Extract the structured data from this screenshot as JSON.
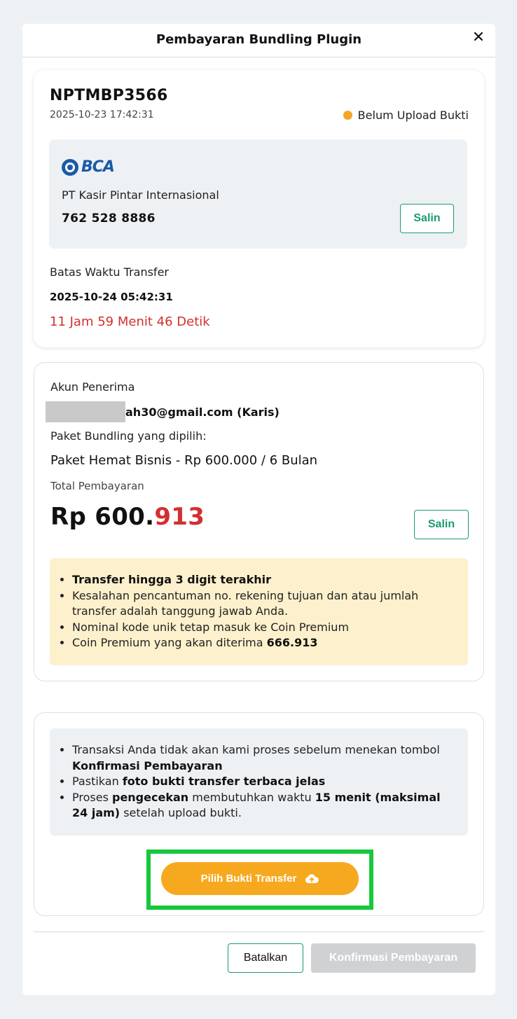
{
  "modal": {
    "title": "Pembayaran Bundling Plugin",
    "close_label": "×"
  },
  "invoice": {
    "id": "NPTMBP3566",
    "date": "2025-10-23 17:42:31",
    "status": "Belum Upload Bukti",
    "status_color": "#f5a623"
  },
  "bank": {
    "logo_text": "BCA",
    "account_name": "PT Kasir Pintar Internasional",
    "account_number": "762 528 8886",
    "copy_label": "Salin"
  },
  "deadline": {
    "label": "Batas Waktu Transfer",
    "value": "2025-10-24 05:42:31",
    "countdown": "11 Jam 59 Menit 46 Detik"
  },
  "receiver": {
    "label": "Akun Penerima",
    "email_visible": "ah30@gmail.com (Karis)"
  },
  "package": {
    "label": "Paket Bundling yang dipilih:",
    "value": "Paket Hemat Bisnis - Rp 600.000 / 6 Bulan"
  },
  "total": {
    "label": "Total Pembayaran",
    "prefix": "Rp 600.",
    "unique_digits": "913",
    "copy_label": "Salin"
  },
  "notice_transfer": {
    "b1_bold": "Transfer hingga ",
    "b1_red": "3 digit terakhir",
    "b2": "Kesalahan pencantuman no. rekening tujuan dan atau jumlah transfer adalah tanggung jawab Anda.",
    "b3": "Nominal kode unik tetap masuk ke Coin Premium",
    "b4_text": "Coin Premium yang akan diterima ",
    "b4_bold": "666.913"
  },
  "notice_upload": {
    "b1_text": "Transaksi Anda tidak akan kami proses sebelum menekan tombol ",
    "b1_bold": "Konfirmasi Pembayaran",
    "b2_text": "Pastikan ",
    "b2_bold": "foto bukti transfer terbaca jelas",
    "b3_text1": "Proses ",
    "b3_bold1": "pengecekan",
    "b3_text2": " membutuhkan waktu ",
    "b3_bold2": "15 menit (maksimal 24 jam)",
    "b3_text3": " setelah upload bukti."
  },
  "upload_button": {
    "label": "Pilih Bukti Transfer",
    "icon": "cloud-upload-icon"
  },
  "footer": {
    "cancel_label": "Batalkan",
    "confirm_label": "Konfirmasi Pembayaran"
  },
  "colors": {
    "accent_green": "#1a9b73",
    "warning_orange": "#f6a91f",
    "error_red": "#d32f2f",
    "highlight_green": "#16c83c"
  }
}
